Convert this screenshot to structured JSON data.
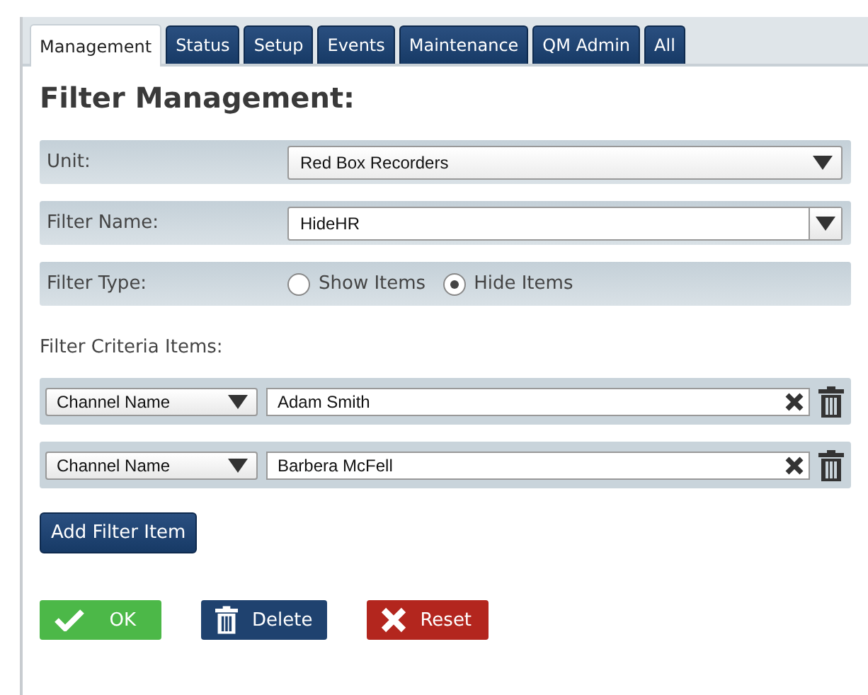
{
  "tabs": [
    {
      "label": "Management",
      "selected": true
    },
    {
      "label": "Status",
      "selected": false
    },
    {
      "label": "Setup",
      "selected": false
    },
    {
      "label": "Events",
      "selected": false
    },
    {
      "label": "Maintenance",
      "selected": false
    },
    {
      "label": "QM Admin",
      "selected": false
    },
    {
      "label": "All",
      "selected": false
    }
  ],
  "heading": "Filter Management:",
  "fields": [
    {
      "kind": "select",
      "label": "Unit:",
      "value": "Red Box Recorders"
    },
    {
      "kind": "combo",
      "label": "Filter Name:",
      "value": "HideHR"
    },
    {
      "kind": "radio",
      "label": "Filter Type:",
      "options": [
        {
          "label": "Show Items",
          "selected": false
        },
        {
          "label": "Hide Items",
          "selected": true
        }
      ]
    }
  ],
  "criteria_label": "Filter Criteria Items:",
  "criteria": [
    {
      "field": "Channel Name",
      "value": "Adam Smith"
    },
    {
      "field": "Channel Name",
      "value": "Barbera McFell"
    }
  ],
  "add_button": "Add Filter Item",
  "actions": [
    {
      "kind": "ok",
      "label": "OK"
    },
    {
      "kind": "delete",
      "label": "Delete"
    },
    {
      "kind": "reset",
      "label": "Reset"
    }
  ]
}
